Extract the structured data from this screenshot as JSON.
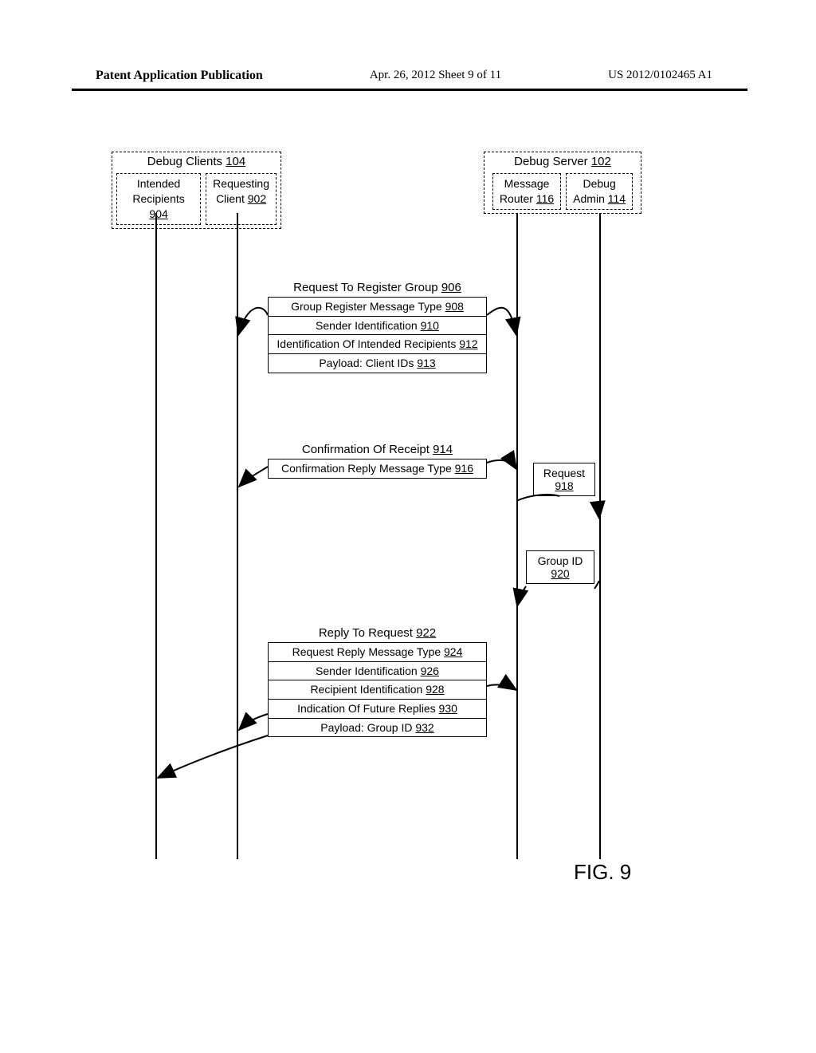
{
  "header": {
    "left": "Patent Application Publication",
    "center": "Apr. 26, 2012   Sheet 9 of 11",
    "right": "US 2012/0102465 A1"
  },
  "figure_label": "FIG. 9",
  "clients": {
    "group_label": "Debug Clients ",
    "group_ref": "104",
    "intended": {
      "line1": "Intended",
      "line2": "Recipients ",
      "ref": "904"
    },
    "requesting": {
      "line1": "Requesting",
      "line2": "Client ",
      "ref": "902"
    }
  },
  "server": {
    "group_label": "Debug Server ",
    "group_ref": "102",
    "router": {
      "line1": "Message",
      "line2": "Router ",
      "ref": "116"
    },
    "admin": {
      "line1": "Debug",
      "line2": "Admin ",
      "ref": "114"
    }
  },
  "msg1": {
    "title": "Request To Register Group ",
    "title_ref": "906",
    "rows": [
      {
        "t": "Group Register Message Type ",
        "r": "908"
      },
      {
        "t": "Sender Identification ",
        "r": "910"
      },
      {
        "t": "Identification Of Intended Recipients ",
        "r": "912"
      },
      {
        "t": "Payload: Client IDs ",
        "r": "913"
      }
    ]
  },
  "msg2": {
    "title": "Confirmation Of Receipt ",
    "title_ref": "914",
    "rows": [
      {
        "t": "Confirmation Reply Message Type ",
        "r": "916"
      }
    ]
  },
  "side1": {
    "label": "Request",
    "ref": "918"
  },
  "side2": {
    "label": "Group ID",
    "ref": "920"
  },
  "msg3": {
    "title": "Reply To Request ",
    "title_ref": "922",
    "rows": [
      {
        "t": "Request Reply Message Type ",
        "r": "924"
      },
      {
        "t": "Sender Identification ",
        "r": "926"
      },
      {
        "t": "Recipient Identification ",
        "r": "928"
      },
      {
        "t": "Indication Of Future Replies ",
        "r": "930"
      },
      {
        "t": "Payload: Group ID ",
        "r": "932"
      }
    ]
  }
}
